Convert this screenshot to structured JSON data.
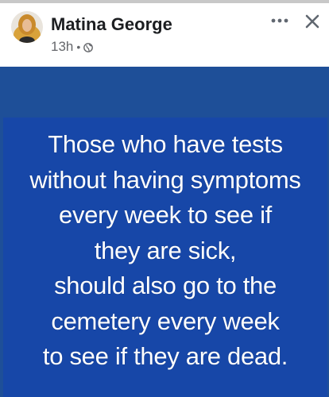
{
  "post": {
    "author": "Matina George",
    "time": "13h",
    "separator": "•",
    "privacy_icon": "globe-icon",
    "more_icon": "more-options-icon",
    "close_icon": "close-icon"
  },
  "image_text": {
    "lines": [
      "Those who have tests",
      "without having symptoms",
      "every week to see if",
      "they are sick,",
      "should also go to the",
      "cemetery every week",
      "to see if they are dead."
    ]
  },
  "colors": {
    "image_background": "#1e4f98",
    "card_background": "#1747a8",
    "text": "#ffffff"
  }
}
